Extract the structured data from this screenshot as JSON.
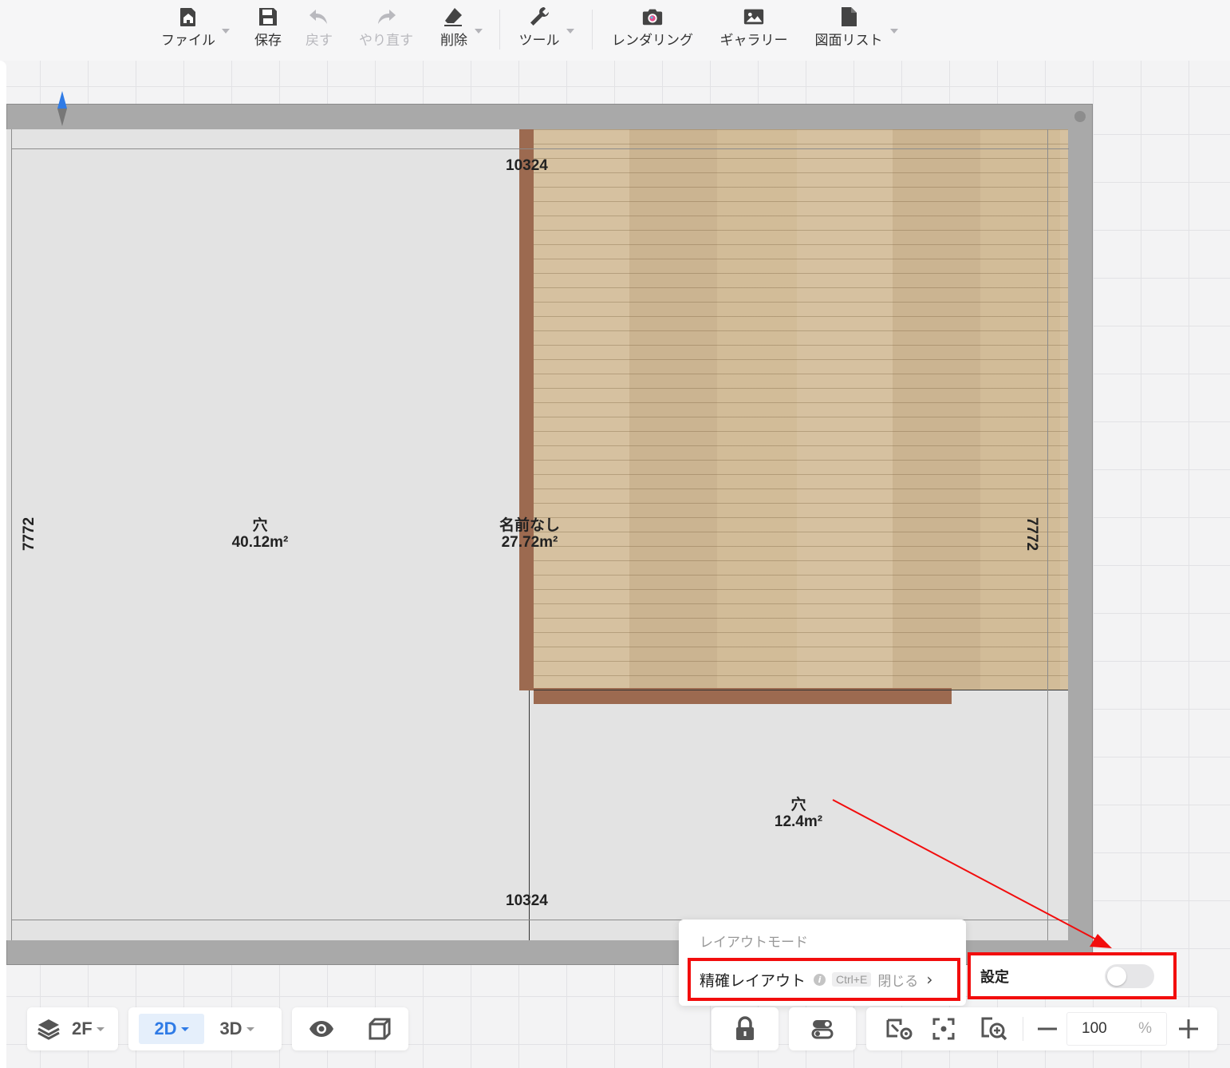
{
  "toolbar": {
    "items": [
      {
        "label": "ファイル",
        "icon": "home-file-icon"
      },
      {
        "label": "保存",
        "icon": "save-icon"
      },
      {
        "label": "戻す",
        "icon": "undo-icon",
        "disabled": true
      },
      {
        "label": "やり直す",
        "icon": "redo-icon",
        "disabled": true
      },
      {
        "label": "削除",
        "icon": "eraser-icon"
      },
      {
        "label": "ツール",
        "icon": "wrench-icon"
      },
      {
        "label": "レンダリング",
        "icon": "camera-icon"
      },
      {
        "label": "ギャラリー",
        "icon": "image-icon"
      },
      {
        "label": "図面リスト",
        "icon": "document-icon"
      }
    ]
  },
  "plan": {
    "dimension_top": "10324",
    "dimension_bottom": "10324",
    "dimension_left": "7772",
    "dimension_right": "7772",
    "rooms": [
      {
        "name": "穴",
        "area": "40.12m²"
      },
      {
        "name": "名前なし",
        "area": "27.72m²"
      },
      {
        "name": "穴",
        "area": "12.4m²"
      }
    ]
  },
  "layout_popup": {
    "title": "レイアウトモード",
    "option_label": "精確レイアウト",
    "shortcut": "Ctrl+E",
    "action": "閉じる"
  },
  "settings": {
    "label": "設定",
    "toggle_on": false
  },
  "bottom_bar": {
    "floor": "2F",
    "view_2d": "2D",
    "view_3d": "3D",
    "zoom_value": "100",
    "zoom_unit": "%"
  },
  "colors": {
    "accent": "#2f7be6",
    "highlight": "#f20d0d",
    "wall": "#a9a9a9",
    "partition": "#9c6a50",
    "wood": "#d3bc98"
  }
}
